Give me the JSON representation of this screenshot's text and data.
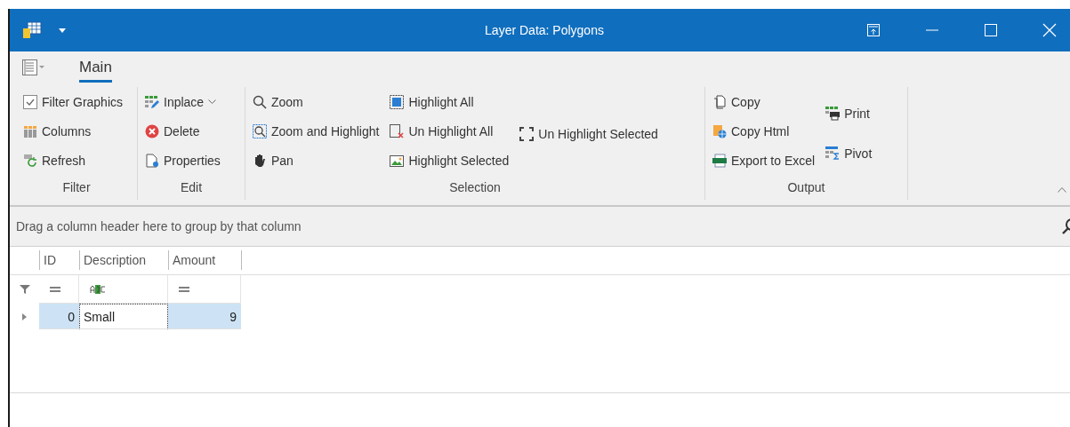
{
  "window": {
    "title": "Layer Data: Polygons"
  },
  "ribbon": {
    "tabs": [
      {
        "label": "Main",
        "selected": true
      }
    ],
    "groups": [
      {
        "label": "Filter",
        "columns": [
          [
            {
              "label": "Filter Graphics",
              "kind": "checkbox",
              "checked": true
            },
            {
              "label": "Columns",
              "kind": "button"
            },
            {
              "label": "Refresh",
              "kind": "button"
            }
          ]
        ]
      },
      {
        "label": "Edit",
        "columns": [
          [
            {
              "label": "Inplace",
              "kind": "dropdown"
            },
            {
              "label": "Delete",
              "kind": "button"
            },
            {
              "label": "Properties",
              "kind": "button"
            }
          ]
        ]
      },
      {
        "label": "Selection",
        "columns": [
          [
            {
              "label": "Zoom",
              "kind": "button"
            },
            {
              "label": "Zoom and Highlight",
              "kind": "button"
            },
            {
              "label": "Pan",
              "kind": "button"
            }
          ],
          [
            {
              "label": "Highlight All",
              "kind": "button"
            },
            {
              "label": "Un Highlight All",
              "kind": "button"
            },
            {
              "label": "Highlight Selected",
              "kind": "button"
            }
          ],
          [
            {
              "label": "Un Highlight Selected",
              "kind": "button"
            }
          ]
        ]
      },
      {
        "label": "Output",
        "columns": [
          [
            {
              "label": "Copy",
              "kind": "button"
            },
            {
              "label": "Copy Html",
              "kind": "button"
            },
            {
              "label": "Export to Excel",
              "kind": "button"
            }
          ],
          [
            {
              "label": "Print",
              "kind": "button"
            },
            {
              "label": "Pivot",
              "kind": "button"
            }
          ]
        ]
      }
    ]
  },
  "group_panel": {
    "placeholder": "Drag a column header here to group by that column"
  },
  "grid": {
    "columns": [
      "ID",
      "Description",
      "Amount"
    ],
    "rows": [
      {
        "cells": [
          {
            "text": "0",
            "focused": false
          },
          {
            "text": "Small",
            "focused": true
          },
          {
            "text": "9",
            "focused": false
          }
        ],
        "selected": true
      }
    ]
  }
}
